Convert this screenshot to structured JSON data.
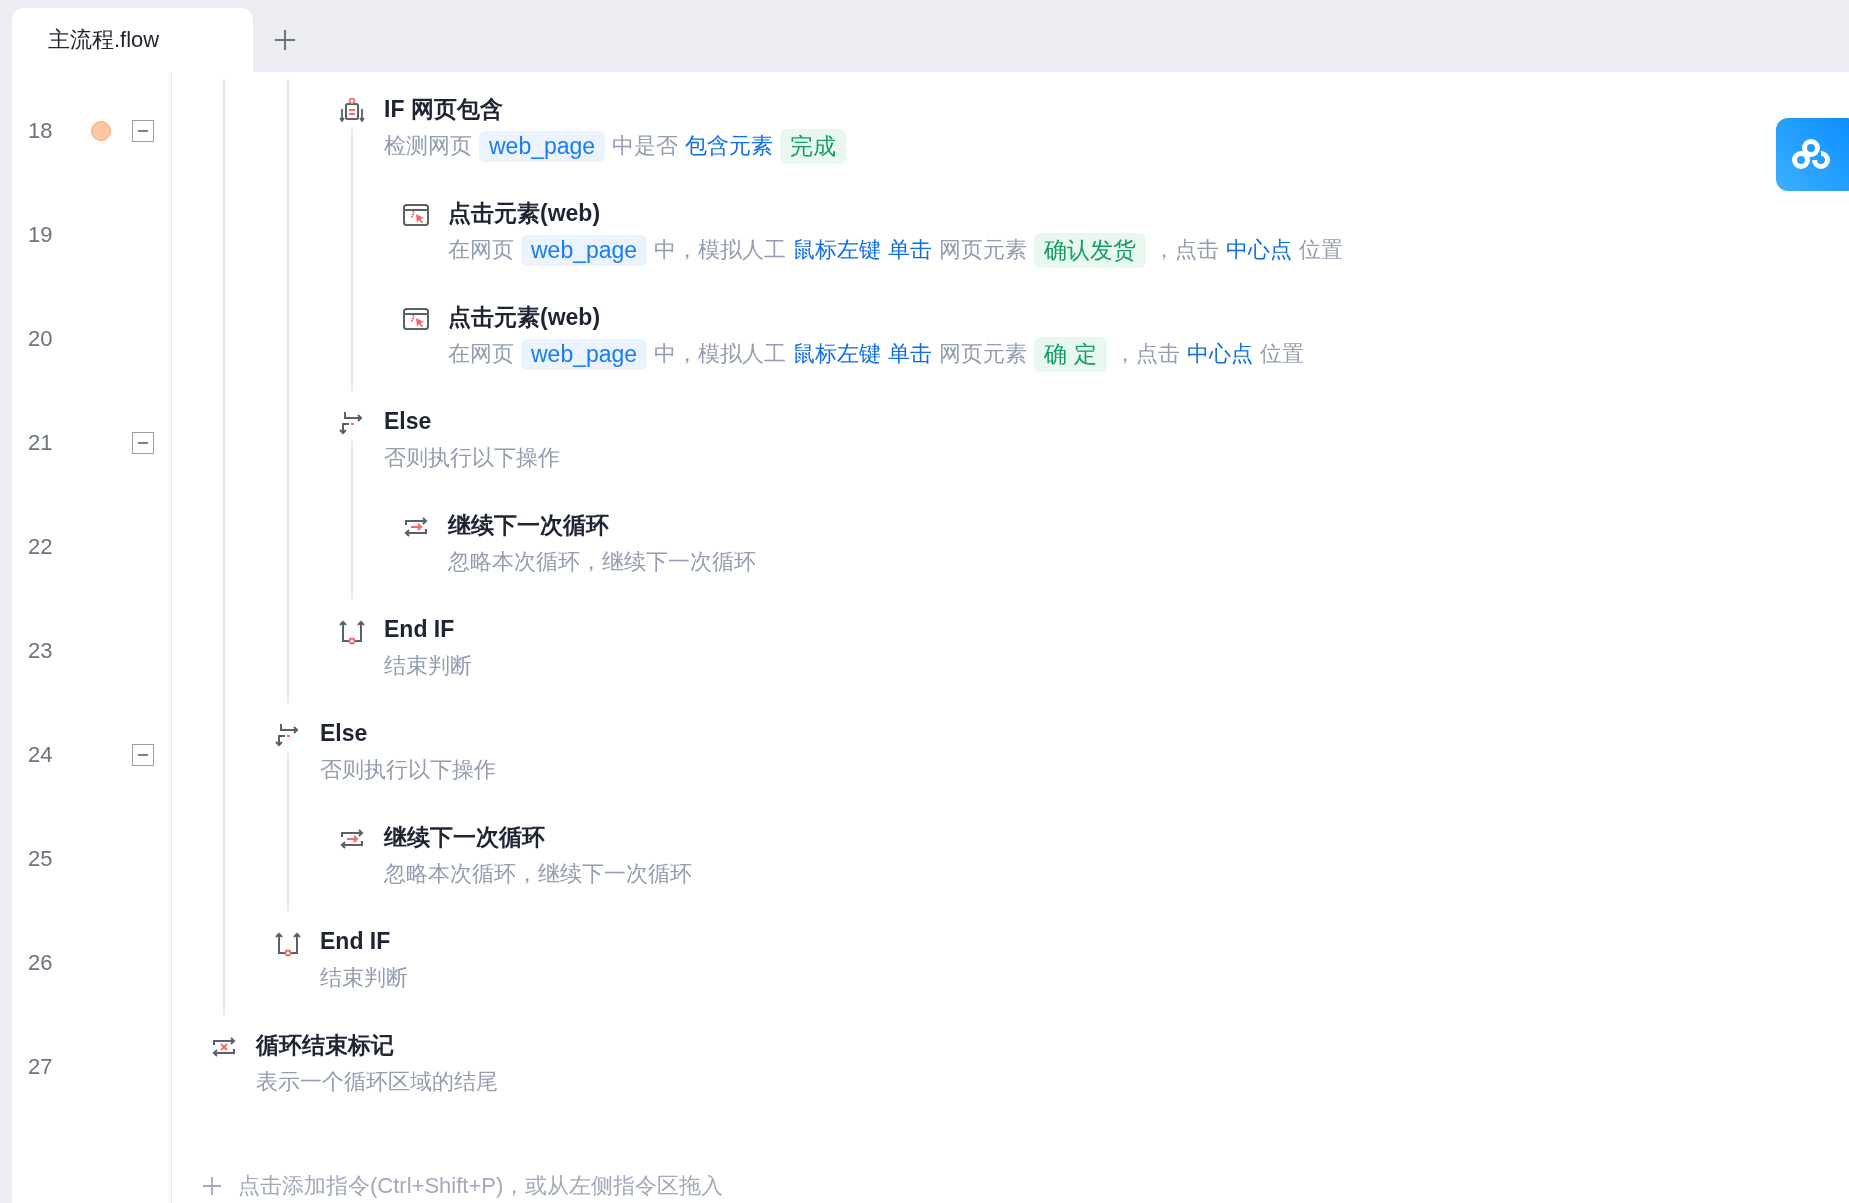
{
  "tabs": [
    {
      "label": "主流程.flow",
      "selected": true
    }
  ],
  "gutter": [
    {
      "line": "18",
      "breakpoint": true,
      "expanded": true
    },
    {
      "line": "19",
      "breakpoint": false
    },
    {
      "line": "20",
      "breakpoint": false
    },
    {
      "line": "21",
      "breakpoint": false,
      "expanded": true
    },
    {
      "line": "22",
      "breakpoint": false
    },
    {
      "line": "23",
      "breakpoint": false
    },
    {
      "line": "24",
      "breakpoint": false,
      "expanded": true
    },
    {
      "line": "25",
      "breakpoint": false
    },
    {
      "line": "26",
      "breakpoint": false
    },
    {
      "line": "27",
      "breakpoint": false
    }
  ],
  "steps": [
    {
      "kind": "continued",
      "children": [
        {
          "kind": "continued",
          "children": [
            {
              "kind": "if",
              "title": "IF 网页包含",
              "desc": [
                {
                  "kind": "text",
                  "text": "检测网页"
                },
                {
                  "kind": "var",
                  "text": "web_page"
                },
                {
                  "kind": "text",
                  "text": "中是否"
                },
                {
                  "kind": "link",
                  "text": "包含元素"
                },
                {
                  "kind": "tag",
                  "text": "完成"
                }
              ],
              "children": [
                {
                  "kind": "click",
                  "title": "点击元素(web)",
                  "desc": [
                    {
                      "kind": "text",
                      "text": "在网页"
                    },
                    {
                      "kind": "var",
                      "text": "web_page"
                    },
                    {
                      "kind": "text",
                      "text": "中，模拟人工"
                    },
                    {
                      "kind": "link",
                      "text": "鼠标左键"
                    },
                    {
                      "kind": "link",
                      "text": "单击"
                    },
                    {
                      "kind": "text",
                      "text": "网页元素"
                    },
                    {
                      "kind": "tag",
                      "text": "确认发货"
                    },
                    {
                      "kind": "text",
                      "text": "，点击"
                    },
                    {
                      "kind": "link",
                      "text": "中心点"
                    },
                    {
                      "kind": "text",
                      "text": "位置"
                    }
                  ]
                },
                {
                  "kind": "click",
                  "title": "点击元素(web)",
                  "desc": [
                    {
                      "kind": "text",
                      "text": "在网页"
                    },
                    {
                      "kind": "var",
                      "text": "web_page"
                    },
                    {
                      "kind": "text",
                      "text": "中，模拟人工"
                    },
                    {
                      "kind": "link",
                      "text": "鼠标左键"
                    },
                    {
                      "kind": "link",
                      "text": "单击"
                    },
                    {
                      "kind": "text",
                      "text": "网页元素"
                    },
                    {
                      "kind": "tag",
                      "text": "确 定"
                    },
                    {
                      "kind": "text",
                      "text": "，点击"
                    },
                    {
                      "kind": "link",
                      "text": "中心点"
                    },
                    {
                      "kind": "text",
                      "text": "位置"
                    }
                  ]
                }
              ]
            },
            {
              "kind": "else",
              "title": "Else",
              "desc": [
                {
                  "kind": "text",
                  "text": "否则执行以下操作"
                }
              ],
              "children": [
                {
                  "kind": "continue",
                  "title": "继续下一次循环",
                  "desc": [
                    {
                      "kind": "text",
                      "text": "忽略本次循环，继续下一次循环"
                    }
                  ]
                }
              ]
            },
            {
              "kind": "endif",
              "title": "End IF",
              "desc": [
                {
                  "kind": "text",
                  "text": "结束判断"
                }
              ]
            }
          ]
        },
        {
          "kind": "else",
          "title": "Else",
          "desc": [
            {
              "kind": "text",
              "text": "否则执行以下操作"
            }
          ],
          "children": [
            {
              "kind": "continue",
              "title": "继续下一次循环",
              "desc": [
                {
                  "kind": "text",
                  "text": "忽略本次循环，继续下一次循环"
                }
              ]
            }
          ]
        },
        {
          "kind": "endif",
          "title": "End IF",
          "desc": [
            {
              "kind": "text",
              "text": "结束判断"
            }
          ]
        }
      ]
    },
    {
      "kind": "loop_end",
      "title": "循环结束标记",
      "desc": [
        {
          "kind": "text",
          "text": "表示一个循环区域的结尾"
        }
      ]
    }
  ],
  "add_hint": "点击添加指令(Ctrl+Shift+P)，或从左侧指令区拖入"
}
